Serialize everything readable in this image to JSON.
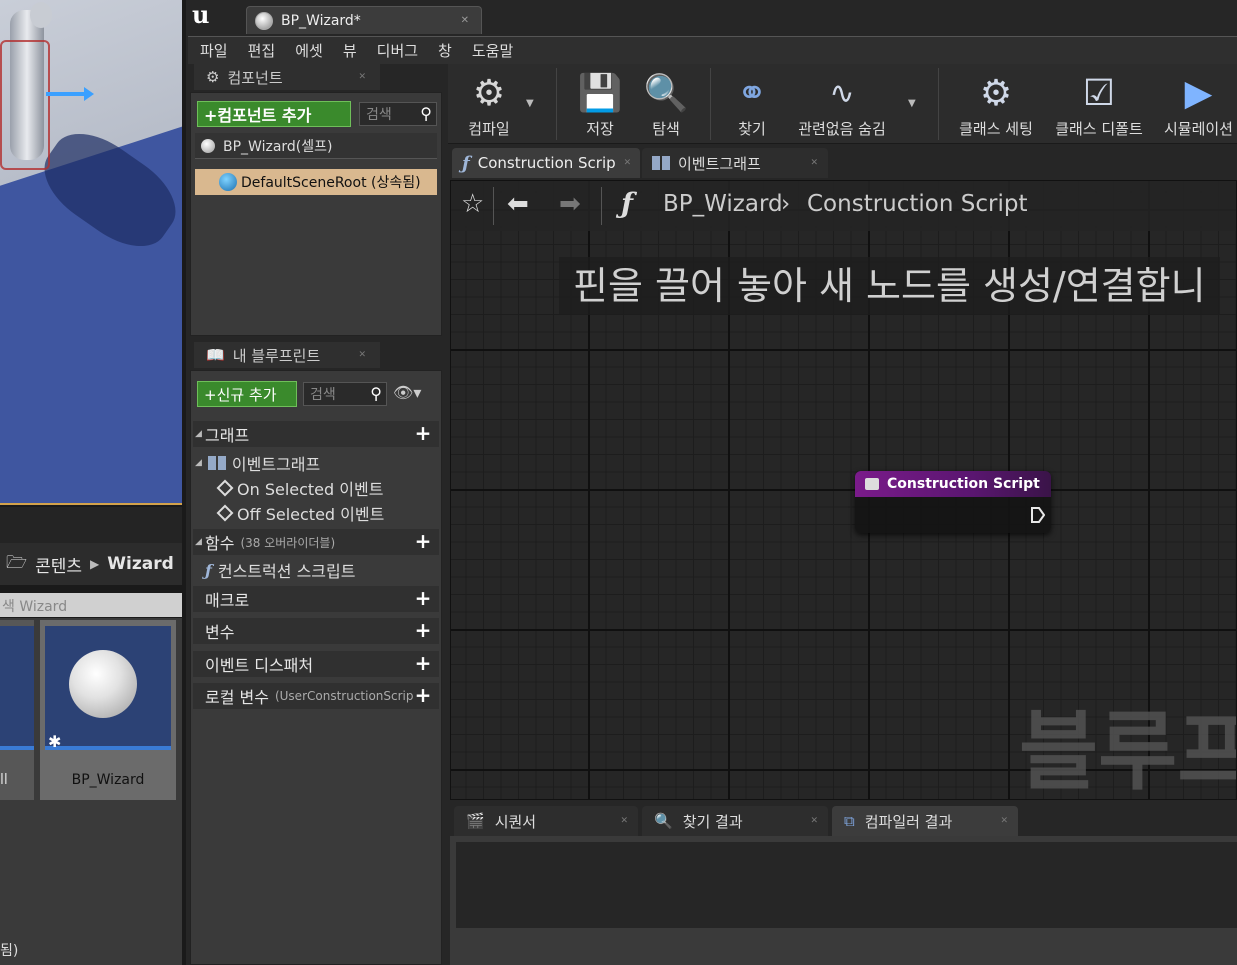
{
  "window": {
    "app_logo": "u",
    "document_tab": "BP_Wizard*"
  },
  "menu": [
    "파일",
    "편집",
    "에셋",
    "뷰",
    "디버그",
    "창",
    "도움말"
  ],
  "content_browser": {
    "path_root": "콘텐츠",
    "path_folder": "Wizard",
    "search_placeholder": "색 Wizard",
    "partial_tile_label": "ll",
    "asset_label": "BP_Wizard",
    "footer_text": "됨)"
  },
  "components": {
    "tab_title": "컴포넌트",
    "add_button": "+컴포넌트 추가",
    "search_placeholder": "검색",
    "self_item": "BP_Wizard(셀프)",
    "root_item": "DefaultSceneRoot (상속됨)"
  },
  "my_blueprint": {
    "tab_title": "내 블루프린트",
    "add_button": "+신규 추가",
    "search_placeholder": "검색",
    "sections": {
      "graphs": "그래프",
      "event_graph": "이벤트그래프",
      "on_selected": "On Selected 이벤트",
      "off_selected": "Off Selected 이벤트",
      "functions": "함수",
      "functions_sub": "(38 오버라이더블)",
      "construction_script": "컨스트럭션 스크립트",
      "macros": "매크로",
      "variables": "변수",
      "event_dispatchers": "이벤트 디스패처",
      "local_variables": "로컬 변수",
      "local_variables_sub": "(UserConstructionScrip"
    }
  },
  "toolbar": {
    "compile": "컴파일",
    "save": "저장",
    "browse": "탐색",
    "find": "찾기",
    "hide_unrelated": "관련없음 숨김",
    "class_settings": "클래스 세팅",
    "class_defaults": "클래스 디폴트",
    "simulation": "시뮬레이션"
  },
  "graph_tabs": {
    "construction_script": "Construction Scrip",
    "event_graph": "이벤트그래프"
  },
  "graph": {
    "breadcrumb_blueprint": "BP_Wizard",
    "breadcrumb_graph": "Construction Script",
    "hint": "핀을 끌어 놓아 새 노드를 생성/연결합니",
    "watermark": "블루프",
    "node_title": "Construction Script"
  },
  "bottom_tabs": {
    "sequencer": "시퀀서",
    "find_results": "찾기 결과",
    "compiler_results": "컴파일러 결과"
  },
  "icons": [
    "gear-icon",
    "floppy-icon",
    "magnifier-icon",
    "binoculars-icon",
    "star-icon",
    "back-arrow-icon",
    "forward-arrow-icon",
    "function-icon",
    "eye-icon",
    "plus-icon"
  ]
}
